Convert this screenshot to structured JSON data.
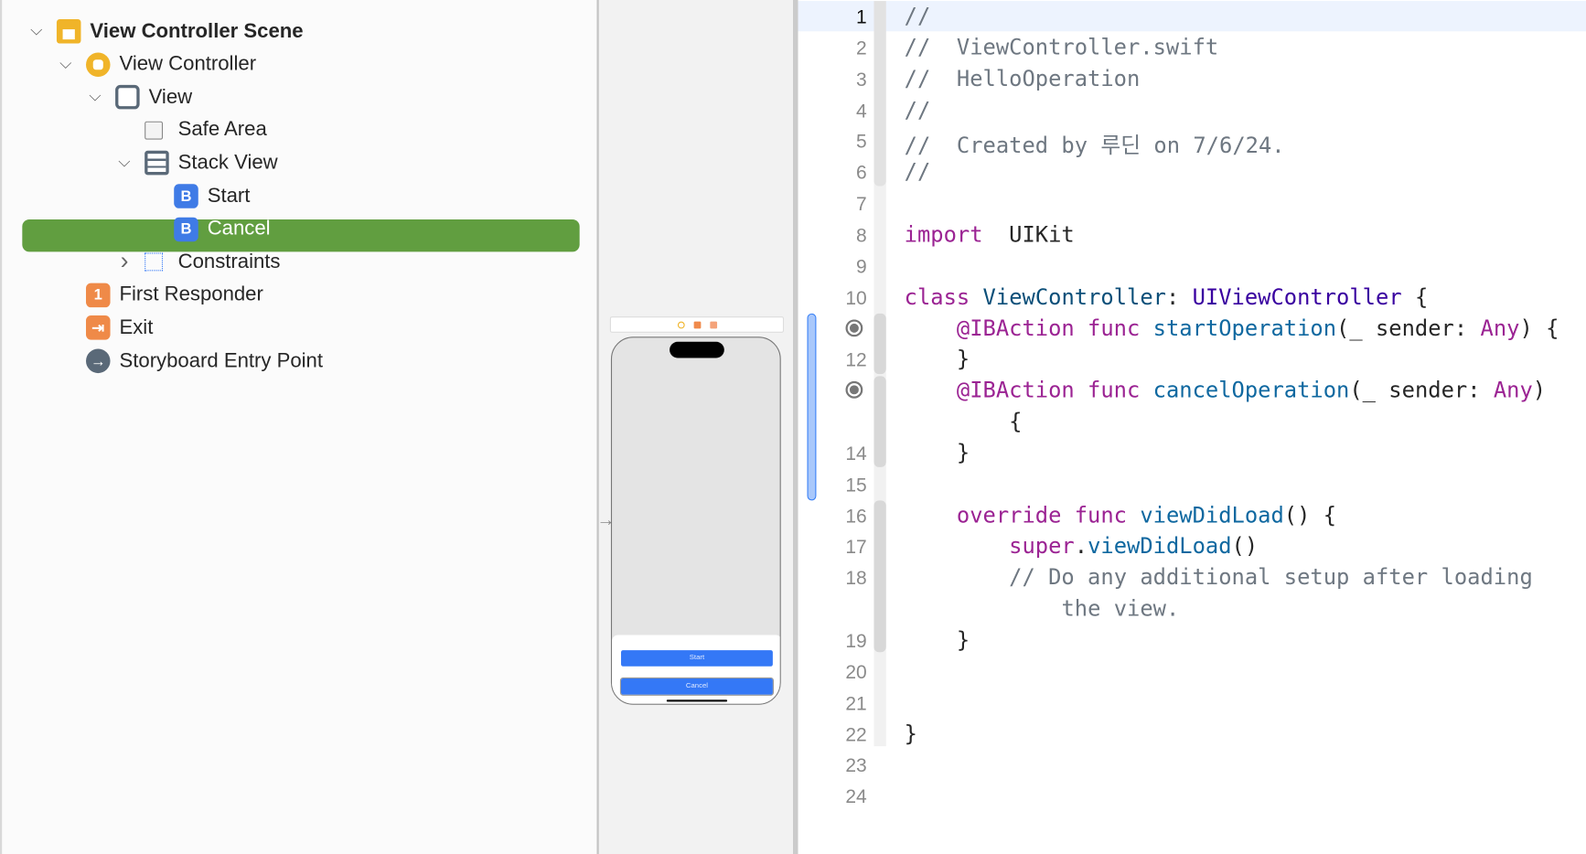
{
  "outline": {
    "items": [
      {
        "label": "View Controller Scene",
        "icon": "scene-icon",
        "expanded": true
      },
      {
        "label": "View Controller",
        "icon": "view-controller-icon",
        "expanded": true
      },
      {
        "label": "View",
        "icon": "view-icon",
        "expanded": true
      },
      {
        "label": "Safe Area",
        "icon": "safe-area-icon"
      },
      {
        "label": "Stack View",
        "icon": "stack-view-icon",
        "expanded": true
      },
      {
        "label": "Start",
        "icon": "button-icon",
        "badge": "B"
      },
      {
        "label": "Cancel",
        "icon": "button-icon",
        "badge": "B",
        "selected": true
      },
      {
        "label": "Constraints",
        "icon": "constraints-icon",
        "expanded": false
      },
      {
        "label": "First Responder",
        "icon": "first-responder-icon",
        "badge": "1"
      },
      {
        "label": "Exit",
        "icon": "exit-icon"
      },
      {
        "label": "Storyboard Entry Point",
        "icon": "entry-point-icon"
      }
    ],
    "selected_color": "#619e40"
  },
  "canvas": {
    "buttons": [
      "Start",
      "Cancel"
    ],
    "button_color": "#3478f6"
  },
  "editor": {
    "current_line": "1",
    "rows": [
      {
        "n": "1",
        "t": [
          [
            "cm",
            "//"
          ]
        ]
      },
      {
        "n": "2",
        "t": [
          [
            "cm",
            "//  ViewController.swift"
          ]
        ]
      },
      {
        "n": "3",
        "t": [
          [
            "cm",
            "//  HelloOperation"
          ]
        ]
      },
      {
        "n": "4",
        "t": [
          [
            "cm",
            "//"
          ]
        ]
      },
      {
        "n": "5",
        "t": [
          [
            "cm",
            "//  Created by 루딘 on 7/6/24."
          ]
        ]
      },
      {
        "n": "6",
        "t": [
          [
            "cm",
            "//"
          ]
        ]
      },
      {
        "n": "7",
        "t": []
      },
      {
        "n": "8",
        "t": [
          [
            "kw",
            "import"
          ],
          [
            "",
            "  UIKit"
          ]
        ]
      },
      {
        "n": "9",
        "t": []
      },
      {
        "n": "10",
        "t": [
          [
            "kw",
            "class"
          ],
          [
            "",
            " "
          ],
          [
            "ty",
            "ViewController"
          ],
          [
            "",
            ": "
          ],
          [
            "cl",
            "UIViewController"
          ],
          [
            "",
            " {"
          ]
        ]
      },
      {
        "n": "",
        "bp": true,
        "t": [
          [
            "",
            "    "
          ],
          [
            "kw",
            "@IBAction func"
          ],
          [
            "",
            " "
          ],
          [
            "fn",
            "startOperation"
          ],
          [
            "",
            "(_ sender: "
          ],
          [
            "kw",
            "Any"
          ],
          [
            "",
            ") {"
          ]
        ]
      },
      {
        "n": "12",
        "t": [
          [
            "",
            "    }"
          ]
        ]
      },
      {
        "n": "",
        "bp": true,
        "t": [
          [
            "",
            "    "
          ],
          [
            "kw",
            "@IBAction func"
          ],
          [
            "",
            " "
          ],
          [
            "fn",
            "cancelOperation"
          ],
          [
            "",
            "(_ sender: "
          ],
          [
            "kw",
            "Any"
          ],
          [
            "",
            ")"
          ]
        ]
      },
      {
        "n": "",
        "t": [
          [
            "",
            "        {"
          ]
        ]
      },
      {
        "n": "14",
        "t": [
          [
            "",
            "    }"
          ]
        ]
      },
      {
        "n": "15",
        "t": []
      },
      {
        "n": "16",
        "t": [
          [
            "",
            "    "
          ],
          [
            "kw",
            "override func"
          ],
          [
            "",
            " "
          ],
          [
            "fn",
            "viewDidLoad"
          ],
          [
            "",
            "() {"
          ]
        ]
      },
      {
        "n": "17",
        "t": [
          [
            "",
            "        "
          ],
          [
            "kw",
            "super"
          ],
          [
            "",
            "."
          ],
          [
            "fn",
            "viewDidLoad"
          ],
          [
            "",
            "()"
          ]
        ]
      },
      {
        "n": "18",
        "t": [
          [
            "",
            "        "
          ],
          [
            "cm",
            "// Do any additional setup after loading"
          ]
        ]
      },
      {
        "n": "",
        "t": [
          [
            "",
            "            "
          ],
          [
            "cm",
            "the view."
          ]
        ]
      },
      {
        "n": "19",
        "t": [
          [
            "",
            "    }"
          ]
        ]
      },
      {
        "n": "20",
        "t": []
      },
      {
        "n": "21",
        "t": []
      },
      {
        "n": "22",
        "t": [
          [
            "",
            "}"
          ]
        ]
      },
      {
        "n": "23",
        "t": []
      },
      {
        "n": "24",
        "t": []
      }
    ]
  }
}
